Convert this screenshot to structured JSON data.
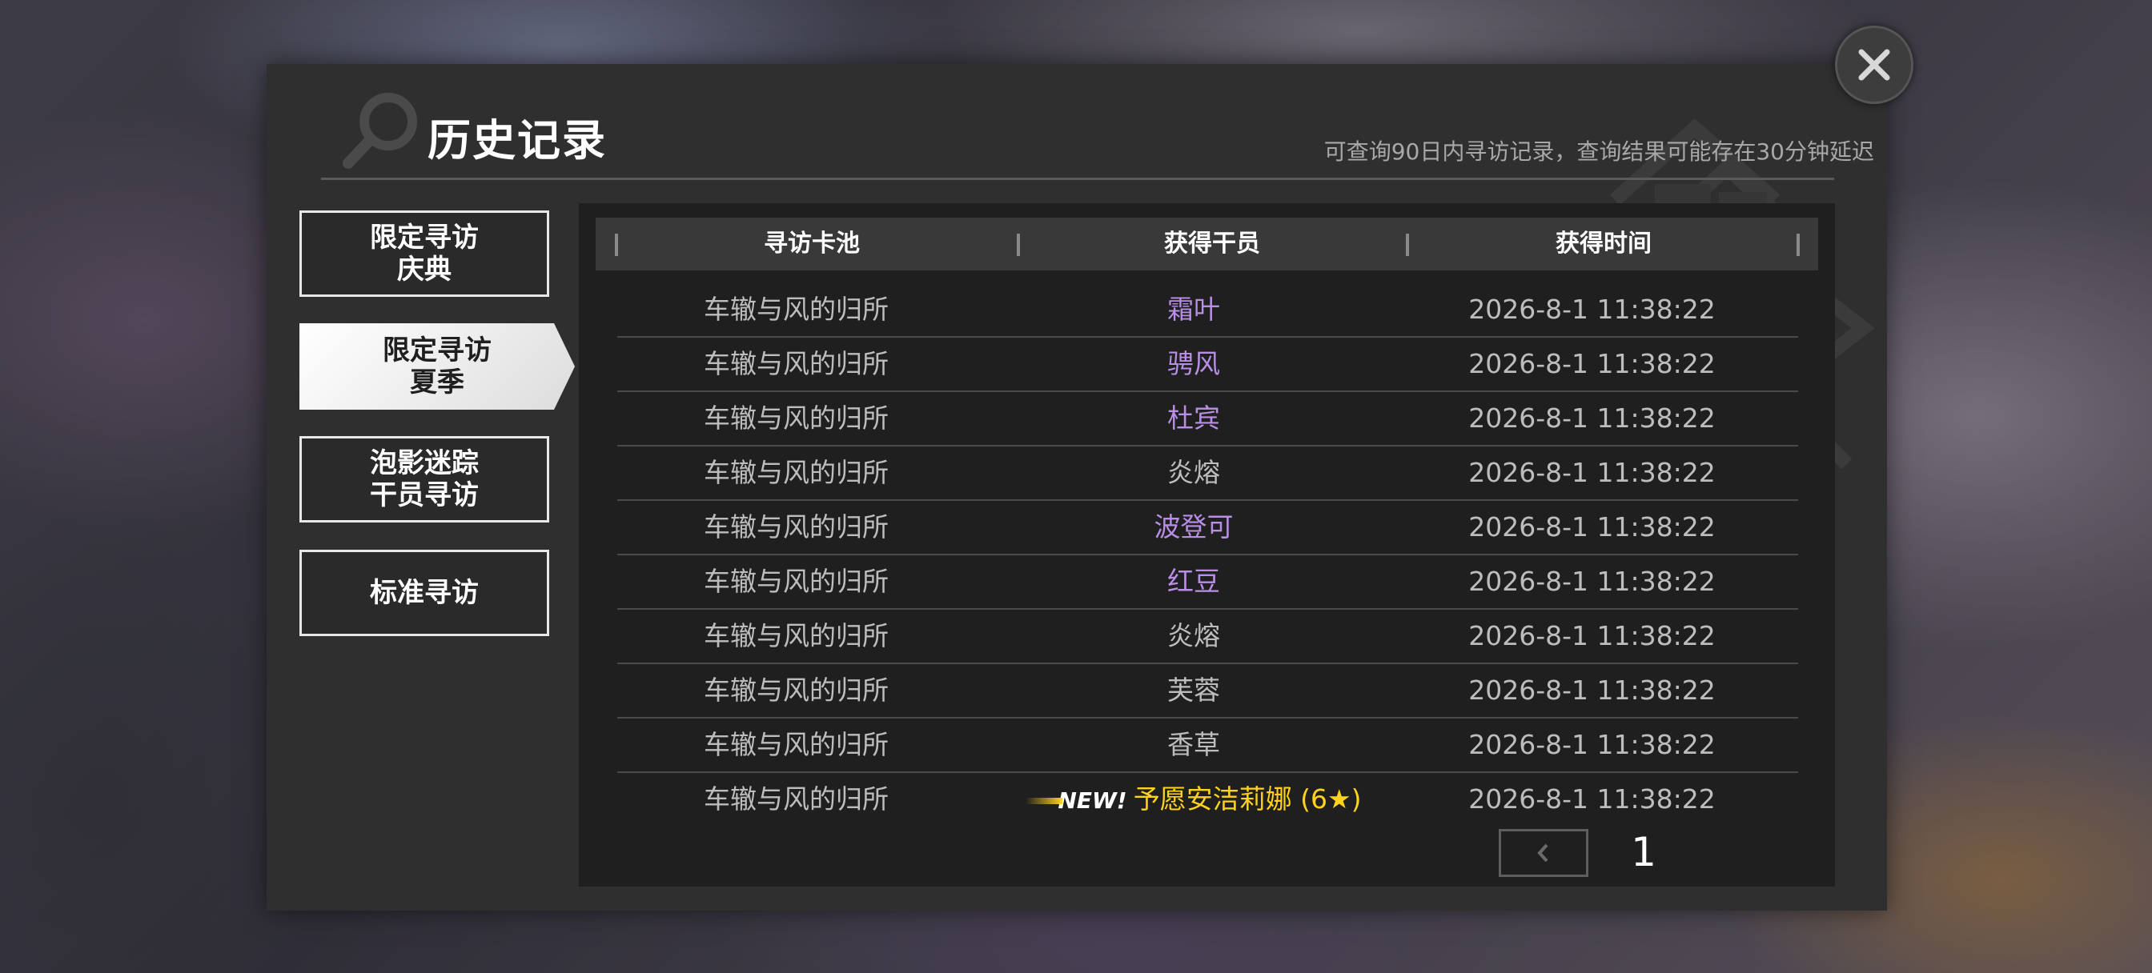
{
  "header": {
    "title": "历史记录",
    "subtitle": "可查询90日内寻访记录，查询结果可能存在30分钟延迟"
  },
  "sidebar": {
    "items": [
      {
        "label": "限定寻访\n庆典",
        "active": false
      },
      {
        "label": "限定寻访\n夏季",
        "active": true
      },
      {
        "label": "泡影迷踪\n干员寻访",
        "active": false
      },
      {
        "label": "标准寻访",
        "active": false
      }
    ]
  },
  "table": {
    "columns": [
      "寻访卡池",
      "获得干员",
      "获得时间"
    ],
    "rows": [
      {
        "pool": "车辙与风的归所",
        "operator": "霜叶",
        "time": "2026-8-1 11:38:22",
        "rarity_color": "#b98ee6"
      },
      {
        "pool": "车辙与风的归所",
        "operator": "骋风",
        "time": "2026-8-1 11:38:22",
        "rarity_color": "#b98ee6"
      },
      {
        "pool": "车辙与风的归所",
        "operator": "杜宾",
        "time": "2026-8-1 11:38:22",
        "rarity_color": "#b98ee6"
      },
      {
        "pool": "车辙与风的归所",
        "operator": "炎熔",
        "time": "2026-8-1 11:38:22",
        "rarity_color": "#bdbdbd"
      },
      {
        "pool": "车辙与风的归所",
        "operator": "波登可",
        "time": "2026-8-1 11:38:22",
        "rarity_color": "#b98ee6"
      },
      {
        "pool": "车辙与风的归所",
        "operator": "红豆",
        "time": "2026-8-1 11:38:22",
        "rarity_color": "#b98ee6"
      },
      {
        "pool": "车辙与风的归所",
        "operator": "炎熔",
        "time": "2026-8-1 11:38:22",
        "rarity_color": "#bdbdbd"
      },
      {
        "pool": "车辙与风的归所",
        "operator": "芙蓉",
        "time": "2026-8-1 11:38:22",
        "rarity_color": "#bdbdbd"
      },
      {
        "pool": "车辙与风的归所",
        "operator": "香草",
        "time": "2026-8-1 11:38:22",
        "rarity_color": "#bdbdbd"
      },
      {
        "pool": "车辙与风的归所",
        "operator": "予愿安洁莉娜 (6★)",
        "time": "2026-8-1 11:38:22",
        "rarity_color": "#ffd21e",
        "new_badge": "NEW!"
      }
    ]
  },
  "pagination": {
    "current_page": "1"
  },
  "icons": {
    "close": "close-icon",
    "prev": "chevron-left-icon",
    "next": "chevron-right-icon",
    "search_deco": "search-icon"
  },
  "colors": {
    "rare_purple": "#b98ee6",
    "six_star_gold": "#ffd21e",
    "common_grey": "#bdbdbd"
  }
}
